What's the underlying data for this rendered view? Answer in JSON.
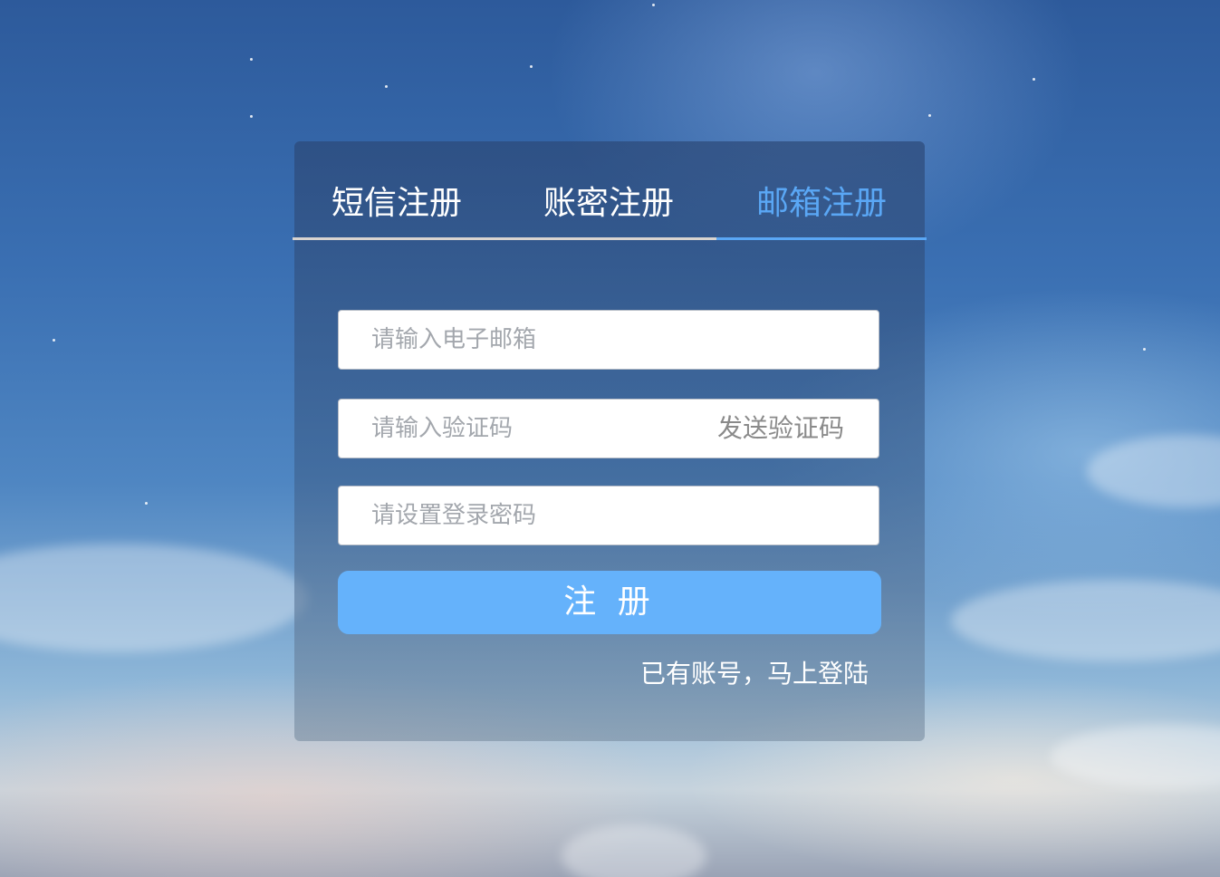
{
  "tabs": [
    {
      "label": "短信注册",
      "active": false
    },
    {
      "label": "账密注册",
      "active": false
    },
    {
      "label": "邮箱注册",
      "active": true
    }
  ],
  "form": {
    "email_placeholder": "请输入电子邮箱",
    "code_placeholder": "请输入验证码",
    "send_code_label": "发送验证码",
    "password_placeholder": "请设置登录密码",
    "submit_label": "注 册",
    "login_link": "已有账号，马上登陆"
  },
  "colors": {
    "accent": "#5aa7f5",
    "button": "#65b2fb"
  }
}
